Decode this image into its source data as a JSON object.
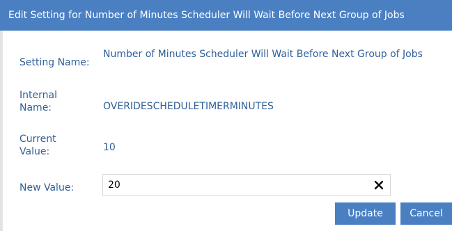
{
  "dialog": {
    "title": "Edit Setting for Number of Minutes Scheduler Will Wait Before Next Group of Jobs"
  },
  "fields": {
    "setting_name_label": "Setting Name:",
    "setting_name_value": "Number of Minutes Scheduler Will Wait Before Next Group of Jobs",
    "internal_name_label": "Internal Name:",
    "internal_name_value": "OVERIDESCHEDULETIMERMINUTES",
    "current_value_label": "Current Value:",
    "current_value_value": "10",
    "new_value_label": "New Value:",
    "new_value_input": "20"
  },
  "buttons": {
    "update_label": "Update",
    "cancel_label": "Cancel"
  },
  "icons": {
    "clear": "close-icon"
  },
  "colors": {
    "accent": "#4a80c2",
    "label_text": "#2f5f99"
  }
}
